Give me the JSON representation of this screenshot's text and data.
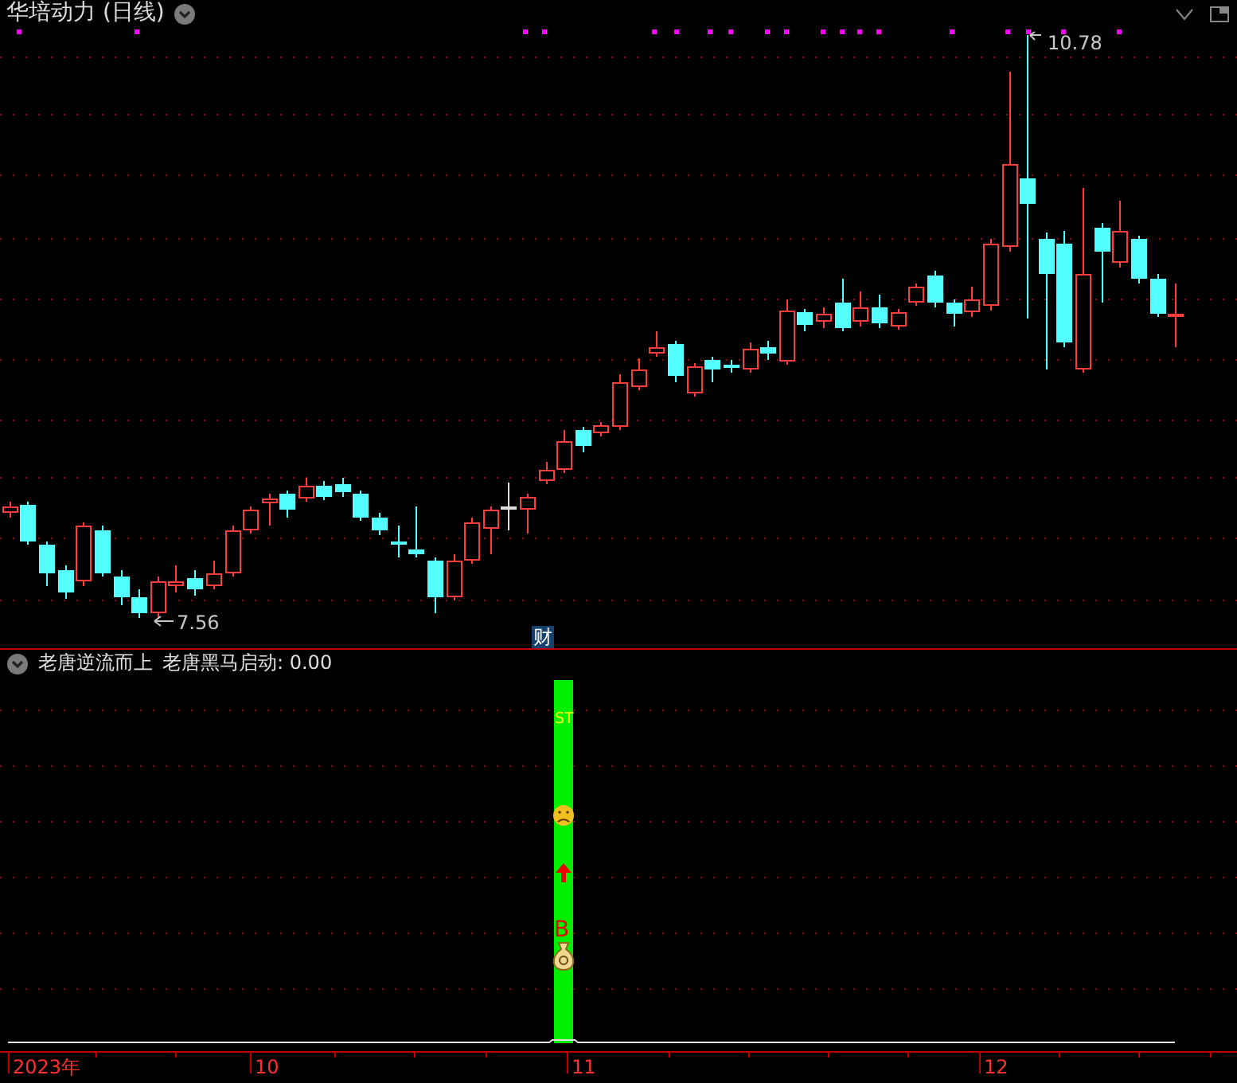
{
  "main_chart": {
    "title": "华培动力 (日线)",
    "high_label": "10.78",
    "low_label": "7.56",
    "finance_marker": "财"
  },
  "indicator_panel": {
    "name": "老唐逆流而上",
    "series_label": "老唐黑马启动: 0.00",
    "signal_text": "ST",
    "buy_text": "B"
  },
  "time_axis": {
    "labels": [
      "2023年",
      "10",
      "11",
      "12"
    ]
  }
}
